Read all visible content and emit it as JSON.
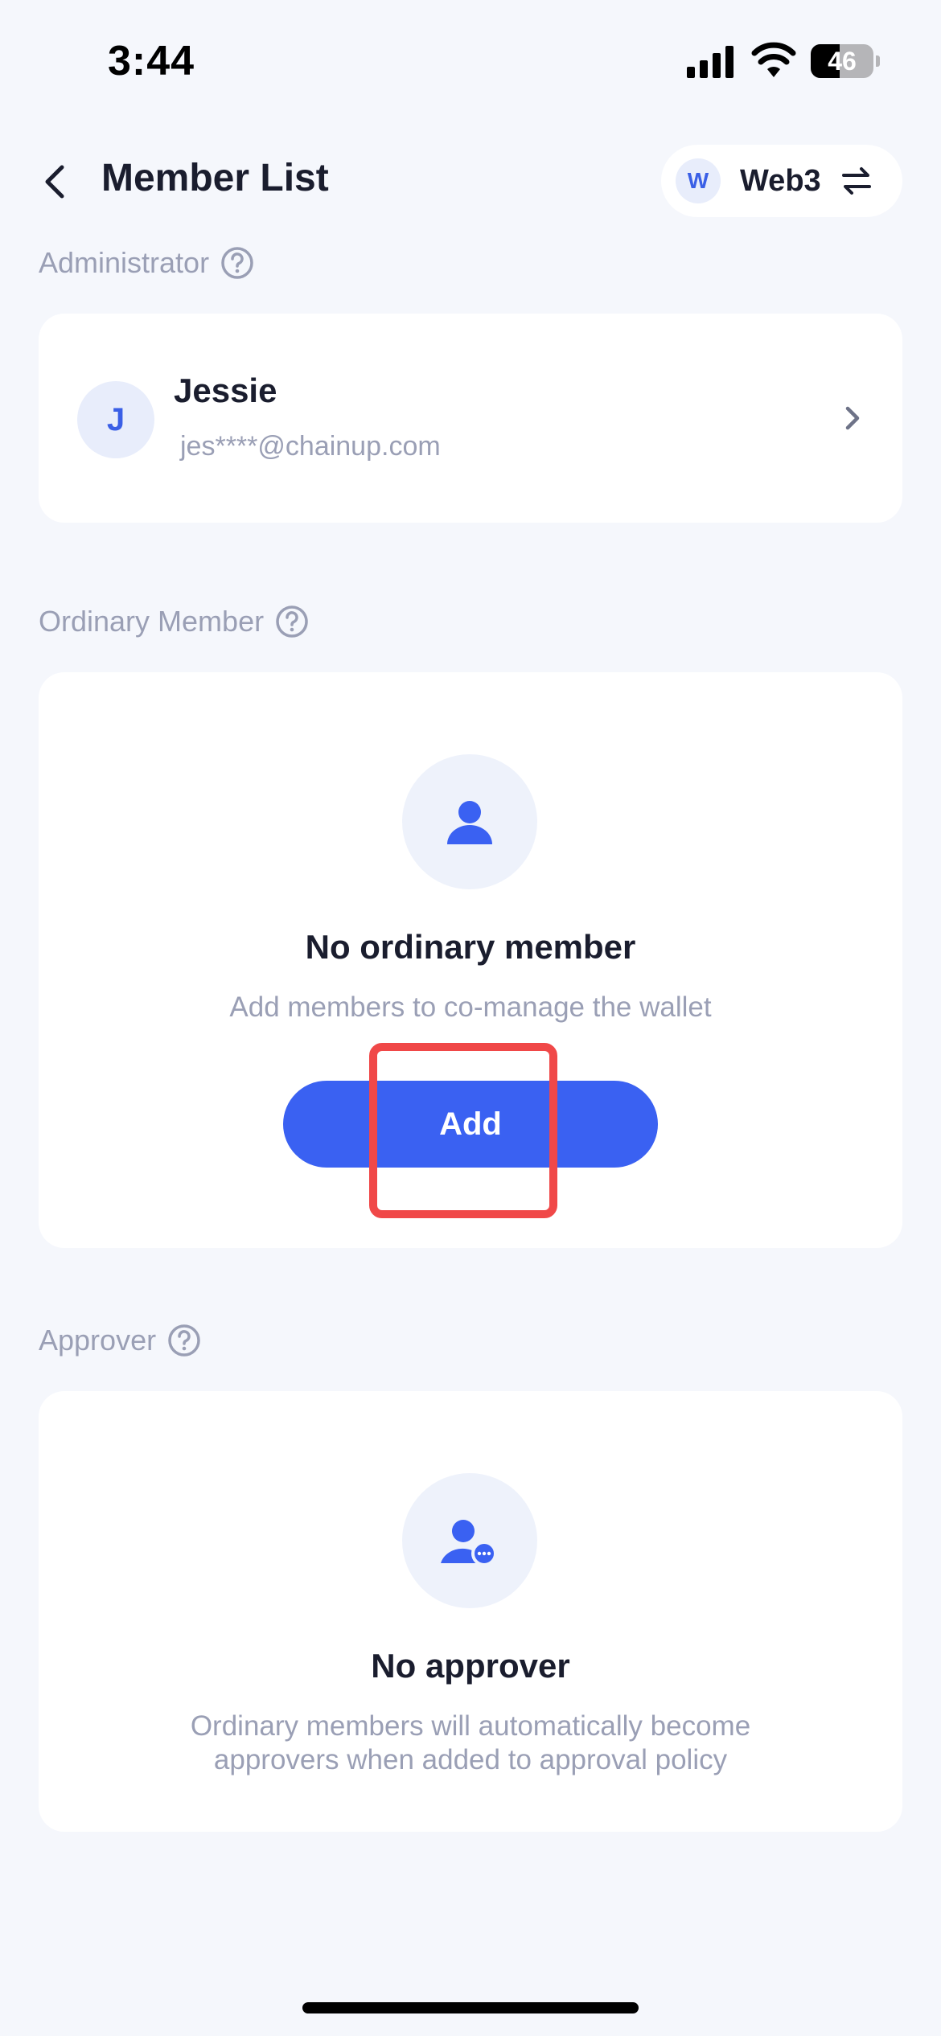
{
  "status_bar": {
    "time": "3:44",
    "battery_level": "46",
    "battery_fraction": 0.46
  },
  "header": {
    "title": "Member List",
    "back_icon": "chevron-left-icon",
    "wallet": {
      "badge": "W",
      "name": "Web3",
      "swap_icon": "swap-arrows-icon"
    }
  },
  "administrator": {
    "label": "Administrator",
    "help_icon": "question-circle-icon",
    "member": {
      "initial": "J",
      "name": "Jessie",
      "email": "jes****@chainup.com"
    }
  },
  "ordinary_member": {
    "label": "Ordinary Member",
    "help_icon": "question-circle-icon",
    "empty_icon": "user-icon",
    "empty_title": "No ordinary member",
    "empty_desc": "Add members to co-manage the wallet",
    "add_label": "Add"
  },
  "approver": {
    "label": "Approver",
    "help_icon": "question-circle-icon",
    "empty_icon": "user-pending-icon",
    "empty_title": "No approver",
    "empty_desc_line1": "Ordinary members will automatically become",
    "empty_desc_line2": "approvers when added to approval policy"
  },
  "colors": {
    "accent": "#3a61f2",
    "highlight": "#f04848",
    "muted_text": "#9a9fb5",
    "background": "#f5f7fc"
  }
}
